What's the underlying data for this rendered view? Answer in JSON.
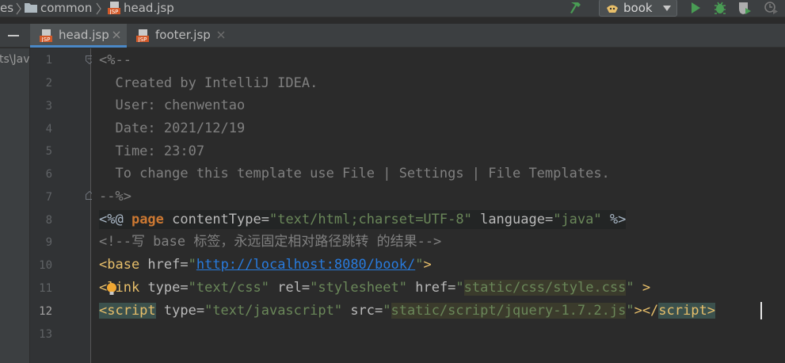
{
  "breadcrumb": {
    "items": [
      {
        "label": "es",
        "icon": "chevron-right-icon"
      },
      {
        "label": "common",
        "icon": "folder-icon"
      },
      {
        "label": "head.jsp",
        "icon": "jsp-file-icon"
      }
    ]
  },
  "toolbar": {
    "run_config_label": "book",
    "icons": [
      "build-hammer-icon",
      "run-icon",
      "debug-icon",
      "coverage-icon",
      "profile-icon"
    ]
  },
  "tabs": [
    {
      "label": "head.jsp",
      "active": true,
      "icon": "jsp-file-icon"
    },
    {
      "label": "footer.jsp",
      "active": false,
      "icon": "jsp-file-icon"
    }
  ],
  "side_panel": {
    "text": "ts\\Jav"
  },
  "gutter": {
    "line_numbers": [
      "1",
      "2",
      "3",
      "4",
      "5",
      "6",
      "7",
      "8",
      "9",
      "10",
      "11",
      "12",
      "13"
    ],
    "current_line": "12"
  },
  "code": {
    "line1": "<%--",
    "line2": "  Created by IntelliJ IDEA.",
    "line3": "  User: chenwentao",
    "line4": "  Date: 2021/12/19",
    "line5": "  Time: 23:07",
    "line6": "  To change this template use File | Settings | File Templates.",
    "line7": "--%>",
    "line8": {
      "open": "<%@ ",
      "kw": "page",
      "attr1": " contentType=",
      "val1": "\"text/html;charset=UTF-8\"",
      "attr2": " language=",
      "val2": "\"java\"",
      "close": " %>"
    },
    "line9": "<!--写 base 标签，永远固定相对路径跳转 的结果-->",
    "line10": {
      "tag": "<base",
      "attr": " href=",
      "q1": "\"",
      "url": "http://localhost:8080/book/",
      "q2": "\"",
      "close": ">"
    },
    "line11": {
      "tag_start": "<",
      "tag_rest": "link",
      "attr1": " type=",
      "val1": "\"text/css\"",
      "attr2": " rel=",
      "val2": "\"stylesheet\"",
      "attr3": " href=",
      "q1": "\"",
      "path": "static/css/style.css",
      "q2": "\"",
      "close": " >"
    },
    "line12": {
      "tag": "<script",
      "attr1": " type=",
      "val1": "\"text/javascript\"",
      "attr2": " src=",
      "q1": "\"",
      "path": "static/script/jquery-1.7.2.js",
      "q2": "\"",
      "mid": "></",
      "end_tag": "script",
      "close": ">"
    }
  },
  "colors": {
    "editor_bg": "#2b2b2b",
    "comment": "#808080",
    "tag": "#e8bf6a",
    "string": "#6a8759",
    "keyword": "#cc7832",
    "url": "#287bde",
    "accent_tab": "#4a88c7"
  }
}
